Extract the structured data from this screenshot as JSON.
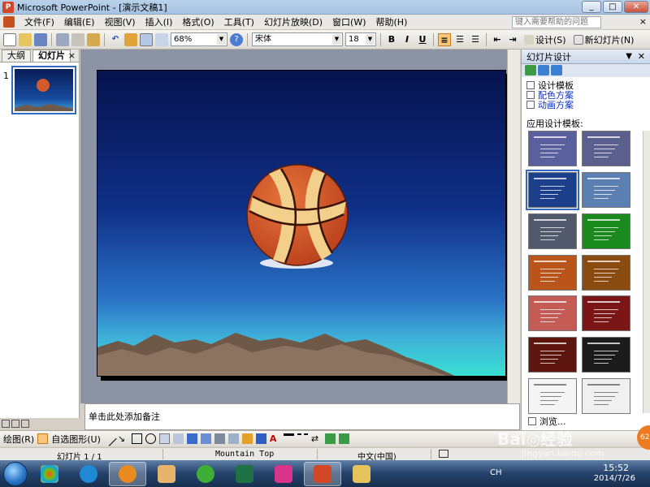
{
  "window": {
    "title": "Microsoft PowerPoint - [演示文稿1]",
    "minimize": "_",
    "maximize": "□",
    "close": "✕"
  },
  "menu": {
    "items": [
      "文件(F)",
      "编辑(E)",
      "视图(V)",
      "插入(I)",
      "格式(O)",
      "工具(T)",
      "幻灯片放映(D)",
      "窗口(W)",
      "帮助(H)"
    ],
    "help_placeholder": "键入需要帮助的问题",
    "close": "×"
  },
  "toolbar": {
    "zoom": "68%",
    "font_name": "宋体",
    "font_size": "18",
    "bold": "B",
    "italic": "I",
    "underline": "U",
    "design_button": "设计(S)",
    "new_slide_button": "新幻灯片(N)"
  },
  "left_pane": {
    "tabs": [
      "大纲",
      "幻灯片"
    ],
    "active_tab": "幻灯片",
    "close": "×",
    "slide_number": "1"
  },
  "notes": {
    "placeholder": "单击此处添加备注"
  },
  "task_pane": {
    "title": "幻灯片设计",
    "links": [
      {
        "label": "设计模板",
        "icon": "design-template-icon"
      },
      {
        "label": "配色方案",
        "icon": "color-scheme-icon"
      },
      {
        "label": "动画方案",
        "icon": "animation-scheme-icon"
      }
    ],
    "section_label": "应用设计模板:",
    "templates": [
      {
        "bg": "#5a5f9e",
        "selected": false
      },
      {
        "bg": "#5b5f8e",
        "selected": false
      },
      {
        "bg": "#1c3f8c",
        "selected": true
      },
      {
        "bg": "#5b7fb0",
        "selected": false
      },
      {
        "bg": "#505a6c",
        "selected": false
      },
      {
        "bg": "#1a8a1e",
        "selected": false
      },
      {
        "bg": "#b9541a",
        "selected": false
      },
      {
        "bg": "#8b4a10",
        "selected": false
      },
      {
        "bg": "#c45b55",
        "selected": false
      },
      {
        "bg": "#7a1616",
        "selected": false
      },
      {
        "bg": "#5d150d",
        "selected": false
      },
      {
        "bg": "#1b1b1b",
        "selected": false
      },
      {
        "bg": "#f5f5f5",
        "selected": false
      },
      {
        "bg": "#f0f0f0",
        "selected": false
      }
    ],
    "browse_label": "浏览..."
  },
  "drawing_toolbar": {
    "draw_label": "绘图(R)",
    "autoshapes_label": "自选图形(U)"
  },
  "status": {
    "slide_info": "幻灯片 1 / 1",
    "design_name": "Mountain Top",
    "language": "中文(中国)"
  },
  "taskbar": {
    "lang": "CH",
    "time": "15:52",
    "date": "2014/7/26"
  },
  "watermark": {
    "brand": "Bai◎经验",
    "site": "jingyan.baidu.com",
    "badge": "62"
  },
  "colors": {
    "slide_top": "#06134e",
    "slide_bottom": "#38e0d2",
    "selection": "#316ac5",
    "ball": "#d35a2a"
  }
}
